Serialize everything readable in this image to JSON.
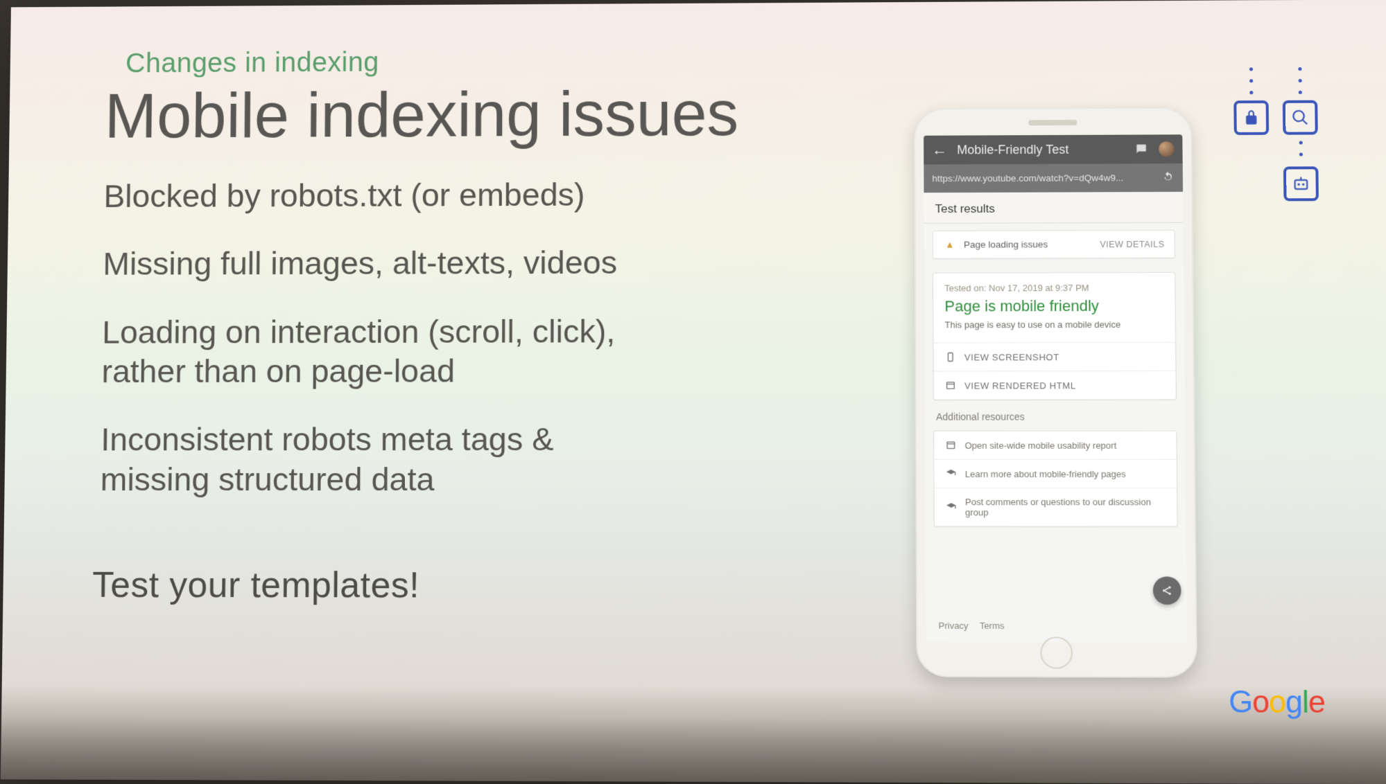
{
  "eyebrow": "Changes in indexing",
  "title": "Mobile indexing issues",
  "bullets": [
    "Blocked by robots.txt (or embeds)",
    "Missing full images, alt-texts, videos",
    "Loading on interaction (scroll, click),\nrather than on page-load",
    "Inconsistent robots meta tags &\nmissing structured data"
  ],
  "callout": "Test your templates!",
  "phone": {
    "app_title": "Mobile-Friendly Test",
    "url": "https://www.youtube.com/watch?v=dQw4w9...",
    "results_label": "Test results",
    "loading_issues": "Page loading issues",
    "view_details": "VIEW DETAILS",
    "tested_on": "Tested on: Nov 17, 2019 at 9:37 PM",
    "verdict": "Page is mobile friendly",
    "verdict_sub": "This page is easy to use on a mobile device",
    "action_screenshot": "VIEW SCREENSHOT",
    "action_html": "VIEW RENDERED HTML",
    "additional_label": "Additional resources",
    "resources": [
      "Open site-wide mobile usability report",
      "Learn more about mobile-friendly pages",
      "Post comments or questions to our discussion group"
    ],
    "privacy": "Privacy",
    "terms": "Terms"
  },
  "brand": "Google"
}
